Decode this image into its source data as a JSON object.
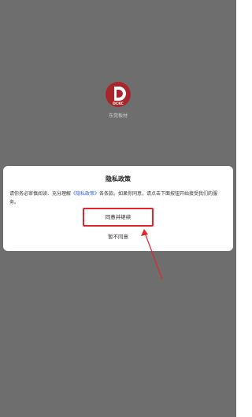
{
  "app": {
    "name": "东莞板材",
    "logo_text": "DCKC",
    "logo_color": "#a8262b"
  },
  "dialog": {
    "title": "隐私政策",
    "body_prefix": "请你务必审慎阅读、充分理解",
    "body_link": "《隐私政策》",
    "body_suffix": "各条款。如果你同意，请点击下面按钮开始接受我们的服务。",
    "agree_label": "同意并继续",
    "disagree_label": "暂不同意"
  },
  "colors": {
    "overlay": "#6e6e6e",
    "highlight": "#e2262b",
    "link": "#3b62d6"
  }
}
